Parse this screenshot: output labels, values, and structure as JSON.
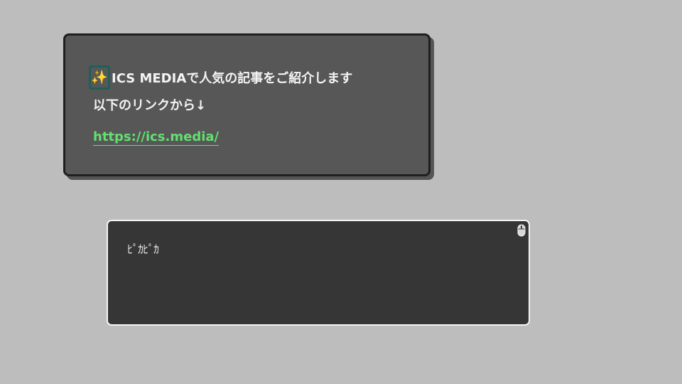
{
  "message_card": {
    "sparkle_emoji": "✨",
    "line1_text": "ICS MEDIAで人気の記事をご紹介します",
    "line2_text": "以下のリンクから↓",
    "link_text": "https://ics.media/"
  },
  "text_box": {
    "content": "ﾋﾟｶﾋﾟｶ",
    "corner_icon": "mouse-icon"
  },
  "colors": {
    "background": "#bdbdbd",
    "card_background": "#575757",
    "card_border": "#1f1f1f",
    "text": "#f4f4f4",
    "link": "#62e070",
    "focus_outline": "#1f5f5a",
    "textbox_background": "#363636",
    "textbox_border": "#f4f4f4"
  }
}
